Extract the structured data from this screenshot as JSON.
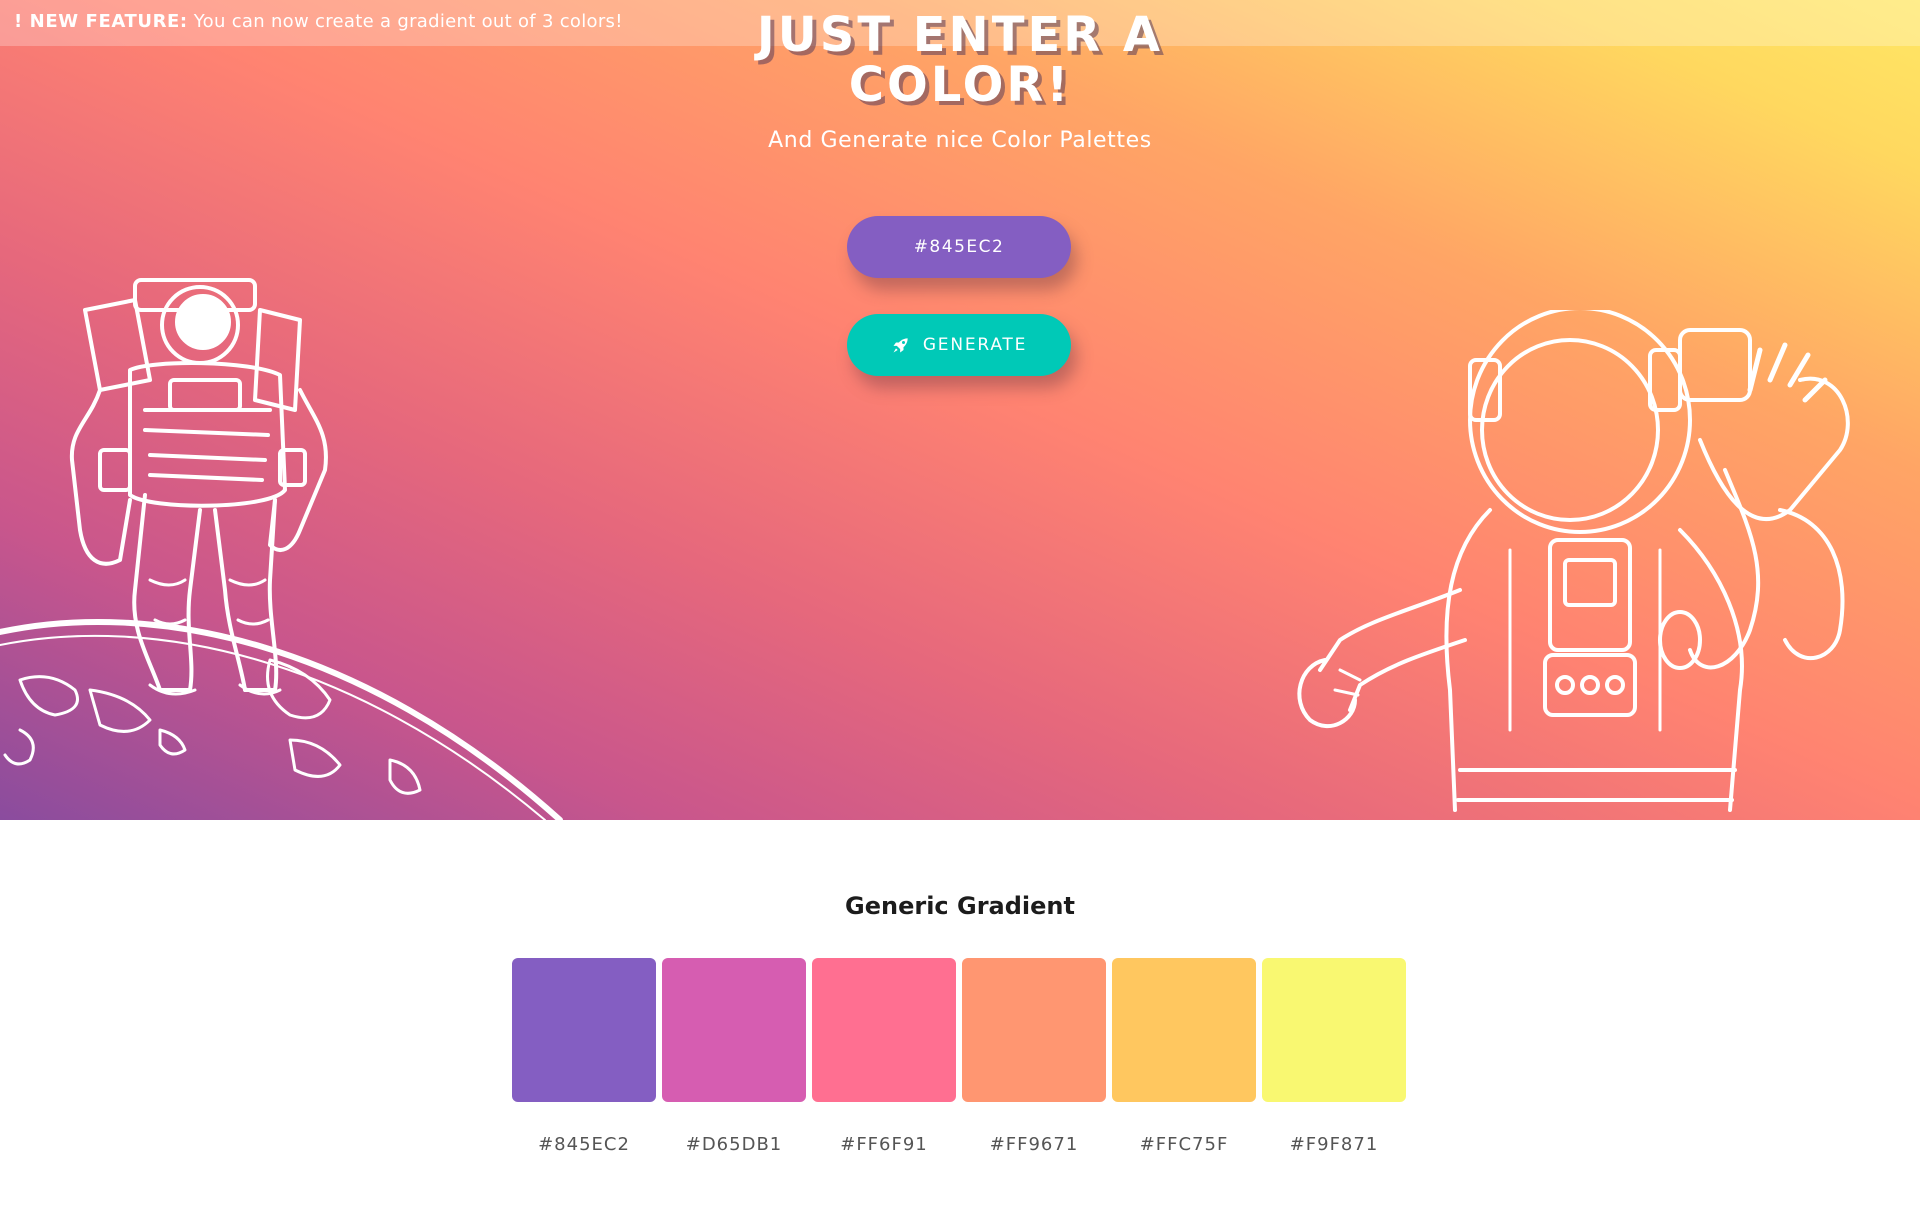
{
  "announcement": {
    "prefix": "! NEW FEATURE:",
    "text": "You can now create a gradient out of 3 colors!"
  },
  "hero": {
    "title": "JUST ENTER A COLOR!",
    "subtitle": "And Generate nice Color Palettes",
    "color_input_value": "#845EC2",
    "generate_label": "GENERATE",
    "generate_icon": "rocket-icon",
    "illustrations": [
      "astronaut-on-planet",
      "astronaut-waving"
    ]
  },
  "palette": {
    "title": "Generic Gradient",
    "swatches": [
      {
        "color": "#845EC2",
        "label": "#845EC2"
      },
      {
        "color": "#D65DB1",
        "label": "#D65DB1"
      },
      {
        "color": "#FF6F91",
        "label": "#FF6F91"
      },
      {
        "color": "#FF9671",
        "label": "#FF9671"
      },
      {
        "color": "#FFC75F",
        "label": "#FFC75F"
      },
      {
        "color": "#F9F871",
        "label": "#F9F871"
      }
    ]
  }
}
